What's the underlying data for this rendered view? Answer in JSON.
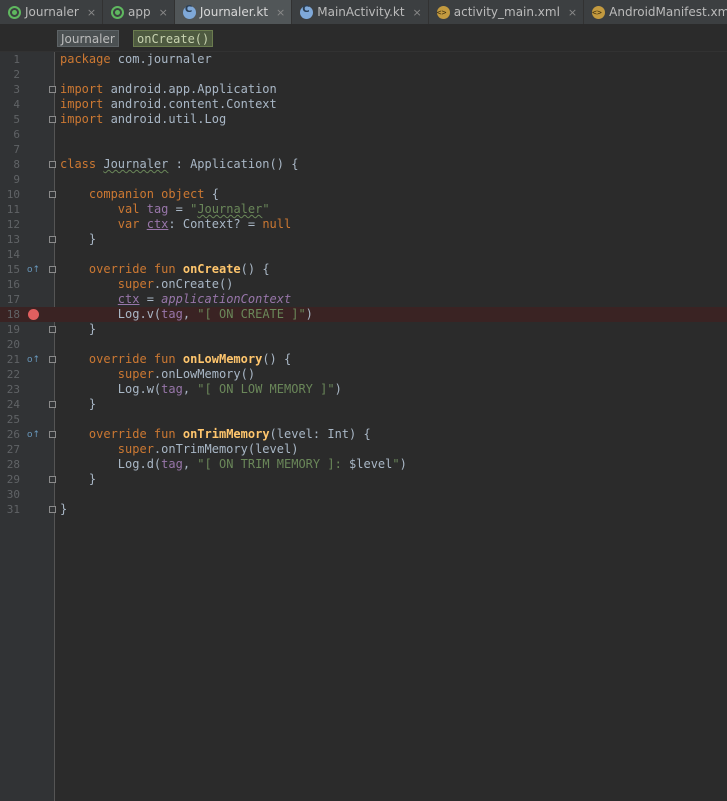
{
  "tabs": [
    {
      "label": "Journaler",
      "icon": "android-icon",
      "active": false
    },
    {
      "label": "app",
      "icon": "android-icon",
      "active": false
    },
    {
      "label": "Journaler.kt",
      "icon": "kotlin-file-icon",
      "active": true
    },
    {
      "label": "MainActivity.kt",
      "icon": "kotlin-file-icon",
      "active": false
    },
    {
      "label": "activity_main.xml",
      "icon": "xml-file-icon",
      "active": false
    },
    {
      "label": "AndroidManifest.xml",
      "icon": "xml-file-icon",
      "active": false
    }
  ],
  "close_glyph": "×",
  "breadcrumb": {
    "class_name": "Journaler",
    "method_name": "onCreate()"
  },
  "colors": {
    "background": "#2b2b2b",
    "keyword": "#cc7832",
    "string": "#6a8759",
    "function": "#ffc66d",
    "property": "#9876aa",
    "text": "#a9b7c6",
    "breakpoint": "#e05f5f"
  },
  "editor": {
    "line_numbers": [
      "1",
      "2",
      "3",
      "4",
      "5",
      "6",
      "7",
      "8",
      "9",
      "10",
      "11",
      "12",
      "13",
      "14",
      "15",
      "16",
      "17",
      "18",
      "19",
      "20",
      "21",
      "22",
      "23",
      "24",
      "25",
      "26",
      "27",
      "28",
      "29",
      "30",
      "31"
    ],
    "tokens": {
      "l1_kw": "package",
      "l1_rest": " com.journaler",
      "l3_kw": "import",
      "l3_rest": " android.app.Application",
      "l4_kw": "import",
      "l4_rest": " android.content.Context",
      "l5_kw": "import",
      "l5_rest": " android.util.Log",
      "l8_kw": "class",
      "l8_sp": " ",
      "l8_name": "Journaler",
      "l8_rest": " : Application() {",
      "l10_kw": "companion object",
      "l10_rest": " {",
      "l11_kw": "val",
      "l11_sp": " ",
      "l11_prop": "tag",
      "l11_eq": " = ",
      "l11_q1": "\"",
      "l11_str": "Journaler",
      "l11_q2": "\"",
      "l12_kw": "var",
      "l12_sp": " ",
      "l12_prop": "ctx",
      "l12_mid": ": Context? = ",
      "l12_null": "null",
      "l13": "}",
      "l15_kw": "override fun",
      "l15_sp": " ",
      "l15_fn": "onCreate",
      "l15_rest": "() {",
      "l16_kw": "super",
      "l16_rest": ".onCreate()",
      "l17_prop": "ctx",
      "l17_eq": " = ",
      "l17_val": "applicationContext",
      "l18_a": "Log.v(",
      "l18_prop": "tag",
      "l18_comma": ", ",
      "l18_str": "\"[ ON CREATE ]\"",
      "l18_end": ")",
      "l19": "}",
      "l21_kw": "override fun",
      "l21_sp": " ",
      "l21_fn": "onLowMemory",
      "l21_rest": "() {",
      "l22_kw": "super",
      "l22_rest": ".onLowMemory()",
      "l23_a": "Log.w(",
      "l23_prop": "tag",
      "l23_comma": ", ",
      "l23_str": "\"[ ON LOW MEMORY ]\"",
      "l23_end": ")",
      "l24": "}",
      "l26_kw": "override fun",
      "l26_sp": " ",
      "l26_fn": "onTrimMemory",
      "l26_rest": "(level: Int) {",
      "l27_kw": "super",
      "l27_rest": ".onTrimMemory(level)",
      "l28_a": "Log.d(",
      "l28_prop": "tag",
      "l28_comma": ", ",
      "l28_str": "\"[ ON TRIM MEMORY ]: ",
      "l28_tmpl": "$level",
      "l28_q": "\"",
      "l28_end": ")",
      "l29": "}",
      "l31": "}"
    },
    "breakpoint_line": "18",
    "override_glyph": "o↑"
  }
}
